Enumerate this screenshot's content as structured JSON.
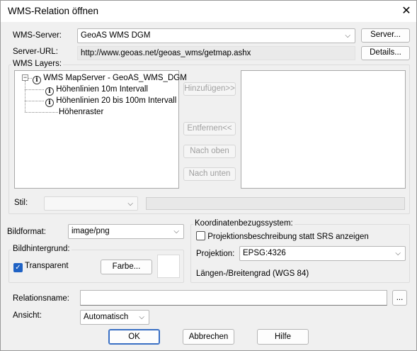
{
  "window": {
    "title": "WMS-Relation öffnen",
    "close_glyph": "✕"
  },
  "server": {
    "label": "WMS-Server:",
    "value": "GeoAS WMS DGM",
    "button": "Server..."
  },
  "url": {
    "label": "Server-URL:",
    "value": "http://www.geoas.net/geoas_wms/getmap.ashx",
    "button": "Details..."
  },
  "layers": {
    "group_title": "WMS Layers:",
    "root": {
      "expander": "−",
      "icon": "info-icon",
      "label": "WMS MapServer - GeoAS_WMS_DGM"
    },
    "items": [
      {
        "icon": "info-icon",
        "label": "Höhenlinien 10m Intervall"
      },
      {
        "icon": "info-icon",
        "label": "Höhenlinien 20 bis 100m Intervall"
      },
      {
        "icon": "",
        "label": "Höhenraster"
      }
    ],
    "add": "Hinzufügen>>",
    "remove": "Entfernen<<",
    "up": "Nach oben",
    "down": "Nach unten",
    "style_label": "Stil:"
  },
  "image": {
    "format_label": "Bildformat:",
    "format_value": "image/png",
    "background_group": "Bildhintergrund:",
    "transparent_label": "Transparent",
    "transparent_checked": true,
    "color_button": "Farbe..."
  },
  "crs": {
    "group_title": "Koordinatenbezugssystem:",
    "projection_desc_label": "Projektionsbeschreibung statt SRS anzeigen",
    "projection_desc_checked": false,
    "projection_label": "Projektion:",
    "projection_value": "EPSG:4326",
    "projection_name": "Längen-/Breitengrad (WGS 84)"
  },
  "relation": {
    "label": "Relationsname:",
    "value": "",
    "browse": "..."
  },
  "view": {
    "label": "Ansicht:",
    "value": "Automatisch"
  },
  "buttons": {
    "ok": "OK",
    "cancel": "Abbrechen",
    "help": "Hilfe"
  },
  "glyphs": {
    "dropdown": "⌵",
    "check": "✓"
  }
}
